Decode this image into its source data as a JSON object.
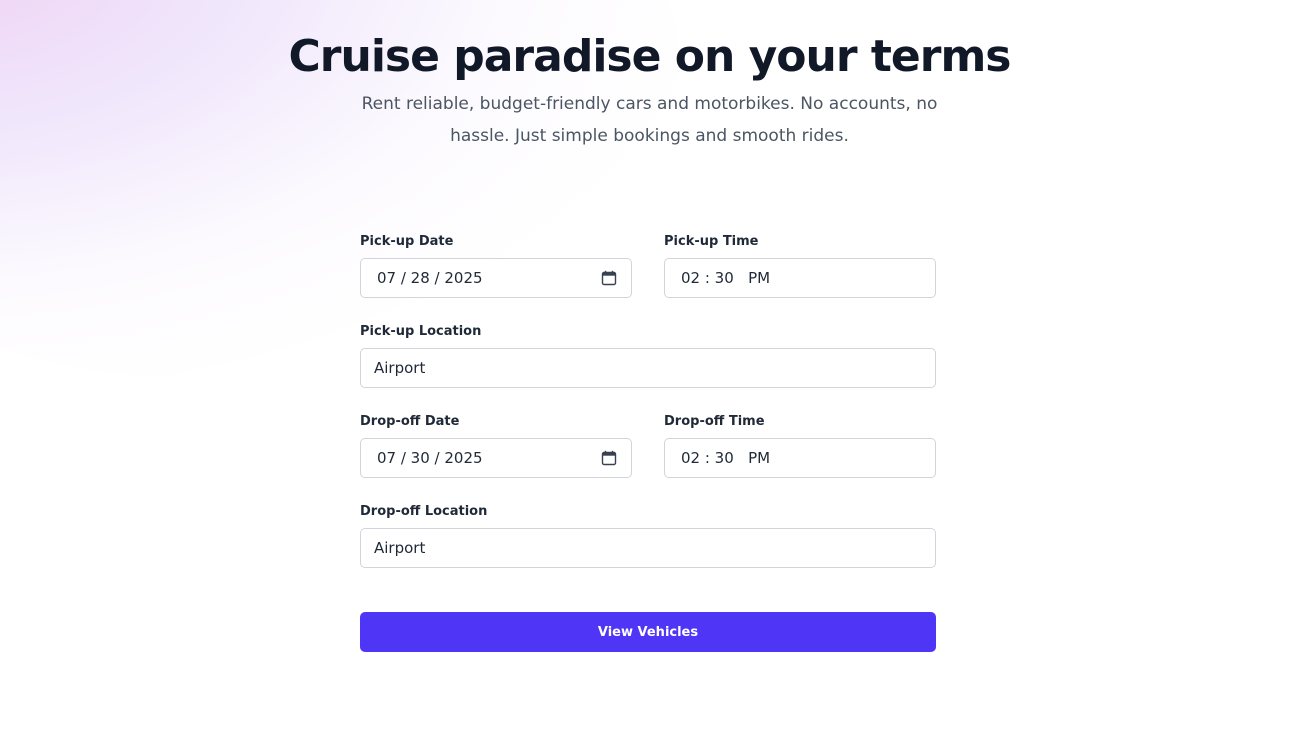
{
  "hero": {
    "title": "Cruise paradise on your terms",
    "subtitle": "Rent reliable, budget-friendly cars and motorbikes. No accounts, no hassle. Just simple bookings and smooth rides."
  },
  "form": {
    "pickup_date": {
      "label": "Pick-up Date",
      "value": "07 / 28 / 2025",
      "icon": "calendar-icon"
    },
    "pickup_time": {
      "label": "Pick-up Time",
      "value": "02 : 30   PM"
    },
    "pickup_location": {
      "label": "Pick-up Location",
      "value": "Airport"
    },
    "dropoff_date": {
      "label": "Drop-off Date",
      "value": "07 / 30 / 2025",
      "icon": "calendar-icon"
    },
    "dropoff_time": {
      "label": "Drop-off Time",
      "value": "02 : 30   PM"
    },
    "dropoff_location": {
      "label": "Drop-off Location",
      "value": "Airport"
    },
    "submit_label": "View Vehicles"
  },
  "colors": {
    "accent": "#4f35f5",
    "text": "#111827",
    "muted": "#4b5563",
    "border": "#d1d5db"
  }
}
